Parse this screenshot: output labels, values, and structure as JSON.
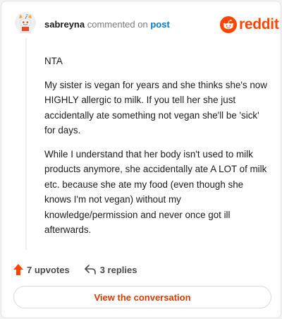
{
  "header": {
    "username": "sabreyna",
    "action_text": "commented on",
    "post_link": "post",
    "brand": "reddit"
  },
  "comment": {
    "paragraphs": [
      "NTA",
      "My sister is vegan for years and she thinks she's now HIGHLY allergic to milk. If you tell her she just accidentally ate something not vegan she'll be 'sick' for days.",
      "While I understand that her body isn't used to milk products anymore, she accidentally ate A LOT of milk etc. because she ate my food (even though she knows I'm not vegan) without my knowledge/permission and never once got ill afterwards."
    ]
  },
  "actions": {
    "upvotes": "7 upvotes",
    "replies": "3 replies"
  },
  "footer": {
    "view_button": "View the conversation"
  },
  "icons": {
    "avatar": "snoo-avatar-icon",
    "brand": "reddit-snoo-icon",
    "upvote": "upvote-arrow-icon",
    "reply": "reply-arrow-icon"
  },
  "colors": {
    "brand_orange": "#ff4500",
    "link_blue": "#0079d3",
    "button_text": "#d93a00"
  }
}
